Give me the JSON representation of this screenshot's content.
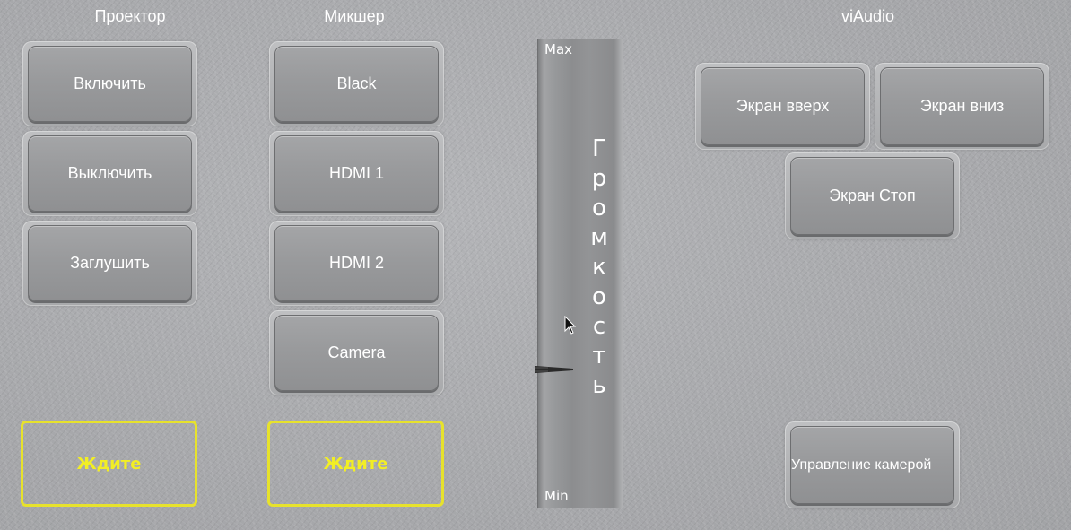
{
  "sections": {
    "projector": "Проектор",
    "mixer": "Микшер",
    "viaudio": "viAudio"
  },
  "projector_buttons": {
    "on": "Включить",
    "off": "Выключить",
    "mute": "Заглушить",
    "status": "Ждите"
  },
  "mixer_buttons": {
    "black": "Black",
    "hdmi1": "HDMI 1",
    "hdmi2": "HDMI 2",
    "camera": "Camera",
    "status": "Ждите"
  },
  "volume": {
    "title_letters": [
      "Г",
      "р",
      "о",
      "м",
      "к",
      "о",
      "с",
      "т",
      "ь"
    ],
    "max_label": "Max",
    "min_label": "Min",
    "level": 0.27
  },
  "viaudio_buttons": {
    "screen_up": "Экран вверх",
    "screen_down": "Экран вниз",
    "screen_stop": "Экран Стоп",
    "camera_control": "Управление камерой"
  },
  "colors": {
    "status_yellow": "#f2ee25",
    "button_face": "#999a9c"
  }
}
